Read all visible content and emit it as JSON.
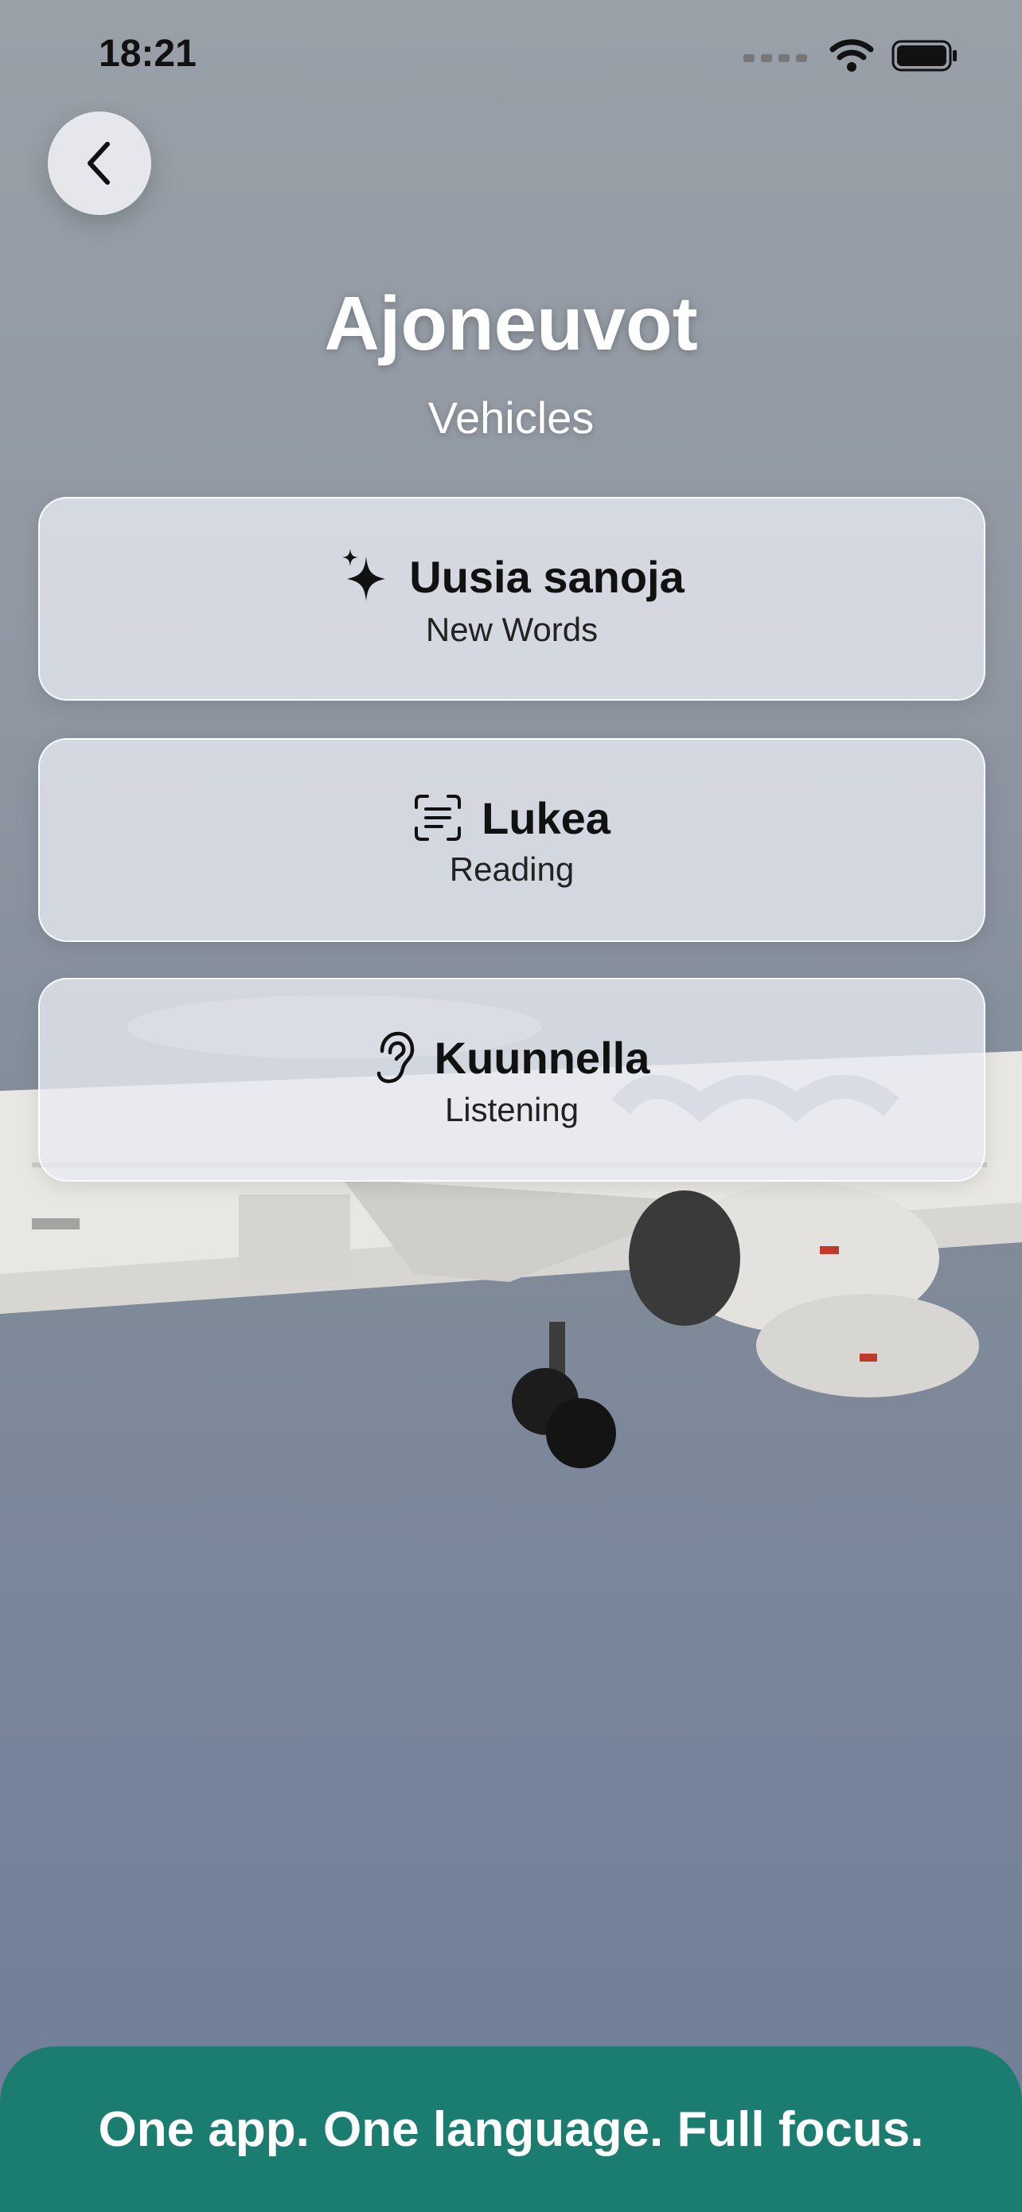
{
  "status_bar": {
    "time": "18:21"
  },
  "header": {
    "title": "Ajoneuvot",
    "subtitle": "Vehicles"
  },
  "cards": [
    {
      "title": "Uusia sanoja",
      "subtitle": "New Words",
      "icon": "sparkles-icon"
    },
    {
      "title": "Lukea",
      "subtitle": "Reading",
      "icon": "document-scan-icon"
    },
    {
      "title": "Kuunnella",
      "subtitle": "Listening",
      "icon": "ear-icon"
    }
  ],
  "footer": {
    "tagline": "One app. One language. Full focus."
  },
  "colors": {
    "accent": "#1b7c70"
  }
}
